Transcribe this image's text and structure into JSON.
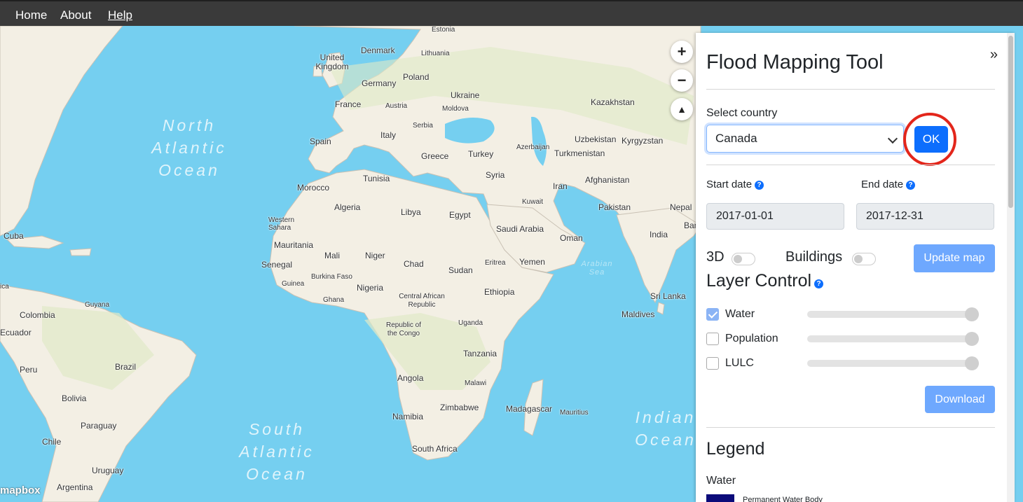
{
  "nav": {
    "home": "Home",
    "about": "About",
    "help": "Help"
  },
  "map": {
    "zoom_in": "+",
    "zoom_out": "−",
    "compass": "▲",
    "attribution": "mapbox",
    "oceans": {
      "north_atlantic": [
        "North",
        "Atlantic",
        "Ocean"
      ],
      "south_atlantic": [
        "South",
        "Atlantic",
        "Ocean"
      ],
      "indian": [
        "Indian",
        "Ocean"
      ],
      "arabian_sea": [
        "Arabian",
        "Sea"
      ]
    },
    "places": {
      "estonia": "Estonia",
      "denmark": "Denmark",
      "lithuania": "Lithuania",
      "uk": "United Kingdom",
      "poland": "Poland",
      "germany": "Germany",
      "ukraine": "Ukraine",
      "france": "France",
      "austria": "Austria",
      "moldova": "Moldova",
      "kazakhstan": "Kazakhstan",
      "serbia": "Serbia",
      "italy": "Italy",
      "spain": "Spain",
      "uzbekistan": "Uzbekistan",
      "kyrgyzstan": "Kyrgyzstan",
      "azerbaijan": "Azerbaijan",
      "turkey": "Turkey",
      "turkmenistan": "Turkmenistan",
      "greece": "Greece",
      "tunisia": "Tunisia",
      "syria": "Syria",
      "afghanistan": "Afghanistan",
      "morocco": "Morocco",
      "iran": "Iran",
      "algeria": "Algeria",
      "libya": "Libya",
      "egypt": "Egypt",
      "kuwait": "Kuwait",
      "pakistan": "Pakistan",
      "nepal": "Nepal",
      "ban": "Ban",
      "western_sahara": "Western Sahara",
      "saudi": "Saudi Arabia",
      "oman": "Oman",
      "india": "India",
      "cuba": "Cuba",
      "mauritania": "Mauritania",
      "mali": "Mali",
      "niger": "Niger",
      "chad": "Chad",
      "sudan": "Sudan",
      "eritrea": "Eritrea",
      "yemen": "Yemen",
      "senegal": "Senegal",
      "burkina": "Burkina Faso",
      "guinea": "Guinea",
      "nigeria": "Nigeria",
      "ethiopia": "Ethiopia",
      "sri_lanka": "Sri Lanka",
      "ica": "ica",
      "colombia": "Colombia",
      "guyana": "Guyana",
      "car": "Central African Republic",
      "ghana": "Ghana",
      "maldives": "Maldives",
      "ecuador": "Ecuador",
      "congo": "Republic of the Congo",
      "uganda": "Uganda",
      "tanzania": "Tanzania",
      "peru": "Peru",
      "brazil": "Brazil",
      "angola": "Angola",
      "malawi": "Malawi",
      "bolivia": "Bolivia",
      "zimbabwe": "Zimbabwe",
      "madagascar": "Madagascar",
      "mauritius": "Mauritius",
      "namibia": "Namibia",
      "paraguay": "Paraguay",
      "chile": "Chile",
      "south_africa": "South Africa",
      "uruguay": "Uruguay",
      "argentina": "Argentina"
    }
  },
  "panel": {
    "collapse": "»",
    "title": "Flood Mapping Tool",
    "country_label": "Select country",
    "country_value": "Canada",
    "ok_button": "OK",
    "start_label": "Start date",
    "end_label": "End date",
    "start_value": "2017-01-01",
    "end_value": "2017-12-31",
    "toggle_3d": "3D",
    "toggle_buildings": "Buildings",
    "update_button": "Update map",
    "layer_control": "Layer Control",
    "layers": [
      {
        "label": "Water",
        "checked": true,
        "opacity": 1
      },
      {
        "label": "Population",
        "checked": false,
        "opacity": 1
      },
      {
        "label": "LULC",
        "checked": false,
        "opacity": 1
      }
    ],
    "download_button": "Download",
    "legend_title": "Legend",
    "legend_water": "Water",
    "legend_item": "Permanent Water Body",
    "help_icon": "?"
  },
  "colors": {
    "accent": "#0d6efd",
    "accent_light": "#6ea8fe",
    "ocean": "#75cff0",
    "land": "#f3efe4",
    "highlight_ring": "#e3261b"
  }
}
